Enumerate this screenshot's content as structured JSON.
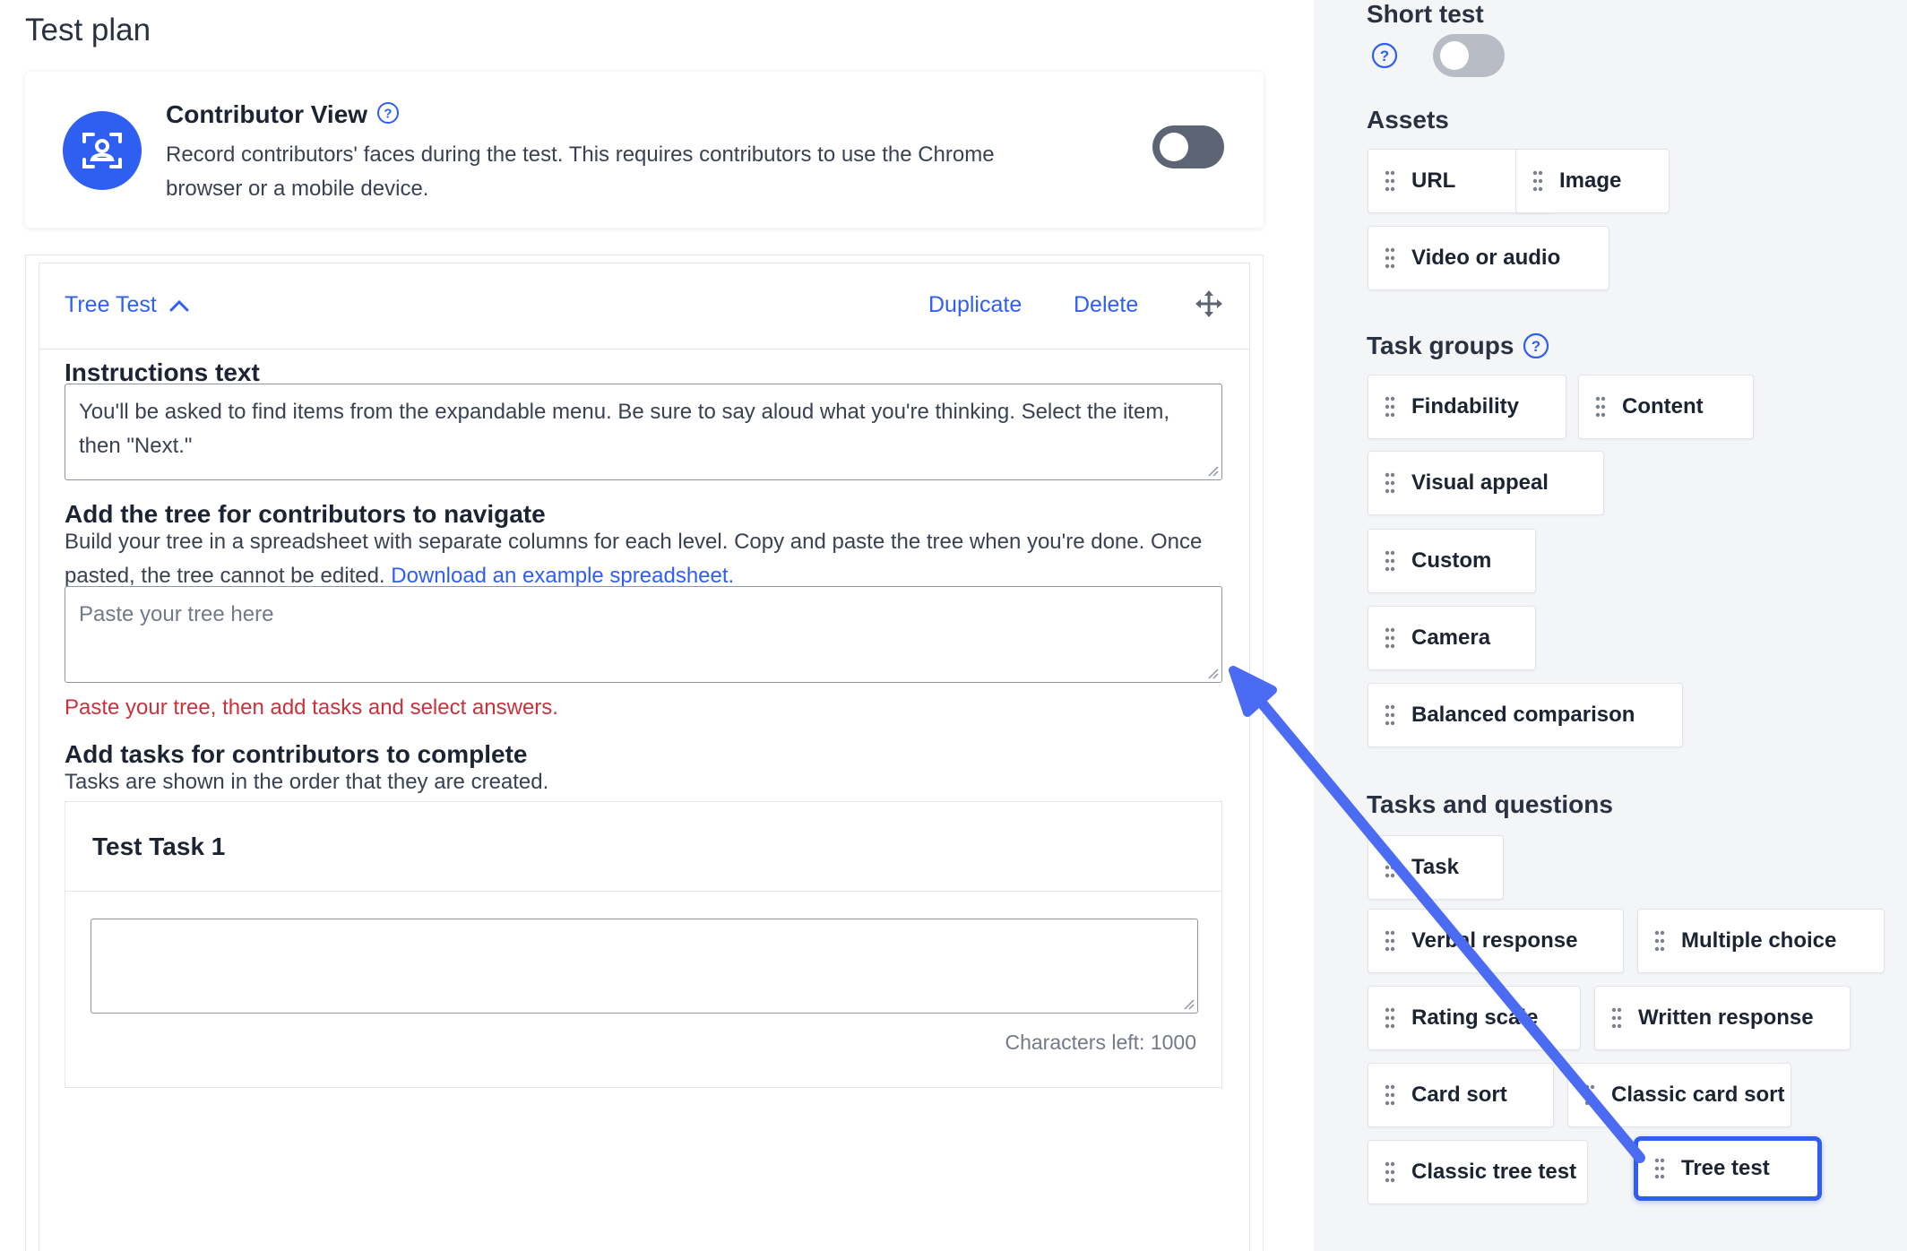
{
  "main": {
    "page_title": "Test plan",
    "contributor_view": {
      "title": "Contributor View",
      "description": "Record contributors' faces during the test. This requires contributors to use the Chrome browser or a mobile device.",
      "toggle_on": false
    },
    "tree_test": {
      "name": "Tree Test",
      "duplicate_label": "Duplicate",
      "delete_label": "Delete",
      "instructions_title": "Instructions text",
      "instructions_value": "You'll be asked to find items from the expandable menu. Be sure to say aloud what you're thinking. Select the item, then \"Next.\"",
      "tree_title": "Add the tree for contributors to navigate",
      "tree_desc": "Build your tree in a spreadsheet with separate columns for each level. Copy and paste the tree when you're done. Once pasted, the tree cannot be edited.",
      "tree_link": "Download an example spreadsheet.",
      "tree_placeholder": "Paste your tree here",
      "tree_error": "Paste your tree, then add tasks and select answers.",
      "tasks_title": "Add tasks for contributors to complete",
      "tasks_desc": "Tasks are shown in the order that they are created.",
      "task1_title": "Test Task 1",
      "task1_value": "",
      "chars_left": "Characters left: 1000"
    }
  },
  "side": {
    "short_test_title": "Short test",
    "short_test_on": false,
    "assets_title": "Assets",
    "assets": [
      "URL",
      "Image",
      "Video or audio"
    ],
    "task_groups_title": "Task groups",
    "task_groups": [
      "Findability",
      "Content",
      "Visual appeal",
      "Custom",
      "Camera",
      "Balanced comparison"
    ],
    "tasks_title": "Tasks and questions",
    "tasks": [
      "Task",
      "Verbal response",
      "Multiple choice",
      "Rating scale",
      "Written response",
      "Card sort",
      "Classic card sort",
      "Classic tree test",
      "Tree test"
    ]
  },
  "colors": {
    "accent": "#2f5ff0",
    "error": "#c8323c",
    "panel_bg": "#f4f5f7",
    "arrow": "#4b6bf2"
  }
}
